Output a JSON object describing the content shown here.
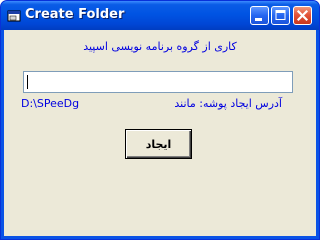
{
  "window": {
    "title": "Create Folder",
    "icon": "folder-window-icon",
    "controls": {
      "minimize_icon": "minimize-icon",
      "maximize_icon": "maximize-icon",
      "close_icon": "close-icon"
    }
  },
  "form": {
    "credit_text": "کاری از گروه برنامه نویسی اسپید",
    "path_input_value": "",
    "address_label": "آدرس ایجاد پوشه: مانند",
    "example_path": "D:\\SPeeDg",
    "create_button_label": "ایجاد"
  },
  "colors": {
    "titlebar": "#0054e3",
    "client_bg": "#ece9d8",
    "label_text": "#0000e0",
    "close_button": "#e3543a"
  }
}
